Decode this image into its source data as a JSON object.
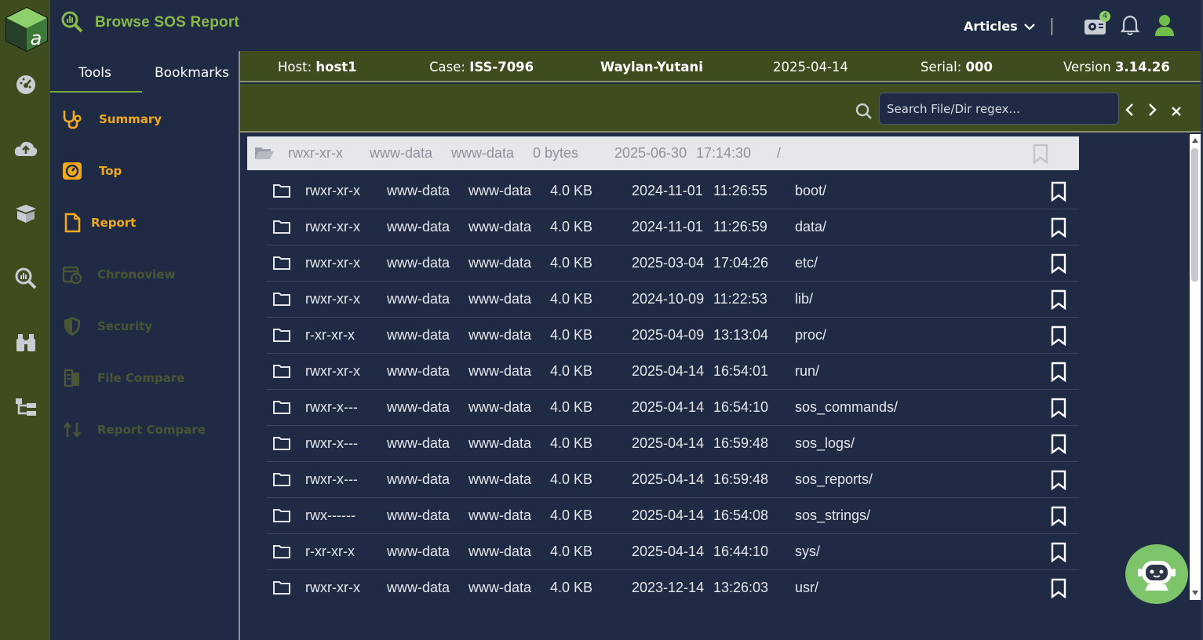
{
  "header": {
    "title": "Browse SOS Report",
    "articles_label": "Articles",
    "notification_count": "4"
  },
  "tools": {
    "tabs": [
      {
        "label": "Tools"
      },
      {
        "label": "Bookmarks"
      }
    ],
    "items": [
      {
        "label": "Summary",
        "icon": "stethoscope-icon",
        "state": "active"
      },
      {
        "label": "Top",
        "icon": "gauge-icon",
        "state": "active"
      },
      {
        "label": "Report",
        "icon": "document-icon",
        "state": "active"
      },
      {
        "label": "Chronoview",
        "icon": "calendar-clock-icon",
        "state": "disabled"
      },
      {
        "label": "Security",
        "icon": "shield-icon",
        "state": "disabled"
      },
      {
        "label": "File Compare",
        "icon": "file-compare-icon",
        "state": "disabled"
      },
      {
        "label": "Report Compare",
        "icon": "report-compare-icon",
        "state": "disabled"
      }
    ]
  },
  "info": {
    "host_label": "Host:",
    "host_value": "host1",
    "case_label": "Case:",
    "case_value": "ISS-7096",
    "org": "Waylan-Yutani",
    "date": "2025-04-14",
    "serial_label": "Serial:",
    "serial_value": "000",
    "version_label": "Version",
    "version_value": "3.14.26"
  },
  "search": {
    "placeholder": "Search File/Dir regex..."
  },
  "parent_dir": {
    "perms": "rwxr-xr-x",
    "owner": "www-data",
    "group": "www-data",
    "size": "0 bytes",
    "date": "2025-06-30",
    "time": "17:14:30",
    "name": "/"
  },
  "files": [
    {
      "perms": "rwxr-xr-x",
      "owner": "www-data",
      "group": "www-data",
      "size": "4.0 KB",
      "date": "2024-11-01",
      "time": "11:26:55",
      "name": "boot/"
    },
    {
      "perms": "rwxr-xr-x",
      "owner": "www-data",
      "group": "www-data",
      "size": "4.0 KB",
      "date": "2024-11-01",
      "time": "11:26:59",
      "name": "data/"
    },
    {
      "perms": "rwxr-xr-x",
      "owner": "www-data",
      "group": "www-data",
      "size": "4.0 KB",
      "date": "2025-03-04",
      "time": "17:04:26",
      "name": "etc/"
    },
    {
      "perms": "rwxr-xr-x",
      "owner": "www-data",
      "group": "www-data",
      "size": "4.0 KB",
      "date": "2024-10-09",
      "time": "11:22:53",
      "name": "lib/"
    },
    {
      "perms": "r-xr-xr-x",
      "owner": "www-data",
      "group": "www-data",
      "size": "4.0 KB",
      "date": "2025-04-09",
      "time": "13:13:04",
      "name": "proc/"
    },
    {
      "perms": "rwxr-xr-x",
      "owner": "www-data",
      "group": "www-data",
      "size": "4.0 KB",
      "date": "2025-04-14",
      "time": "16:54:01",
      "name": "run/"
    },
    {
      "perms": "rwxr-x---",
      "owner": "www-data",
      "group": "www-data",
      "size": "4.0 KB",
      "date": "2025-04-14",
      "time": "16:54:10",
      "name": "sos_commands/"
    },
    {
      "perms": "rwxr-x---",
      "owner": "www-data",
      "group": "www-data",
      "size": "4.0 KB",
      "date": "2025-04-14",
      "time": "16:59:48",
      "name": "sos_logs/"
    },
    {
      "perms": "rwxr-x---",
      "owner": "www-data",
      "group": "www-data",
      "size": "4.0 KB",
      "date": "2025-04-14",
      "time": "16:59:48",
      "name": "sos_reports/"
    },
    {
      "perms": "rwx------",
      "owner": "www-data",
      "group": "www-data",
      "size": "4.0 KB",
      "date": "2025-04-14",
      "time": "16:54:08",
      "name": "sos_strings/"
    },
    {
      "perms": "r-xr-xr-x",
      "owner": "www-data",
      "group": "www-data",
      "size": "4.0 KB",
      "date": "2025-04-14",
      "time": "16:44:10",
      "name": "sys/"
    },
    {
      "perms": "rwxr-xr-x",
      "owner": "www-data",
      "group": "www-data",
      "size": "4.0 KB",
      "date": "2023-12-14",
      "time": "13:26:03",
      "name": "usr/"
    }
  ],
  "colors": {
    "rail_bg": "#3f4d1e",
    "main_bg": "#1f2a44",
    "accent_green": "#8bb84a",
    "active_orange": "#f0a91c",
    "disabled_olive": "#4a5533"
  }
}
